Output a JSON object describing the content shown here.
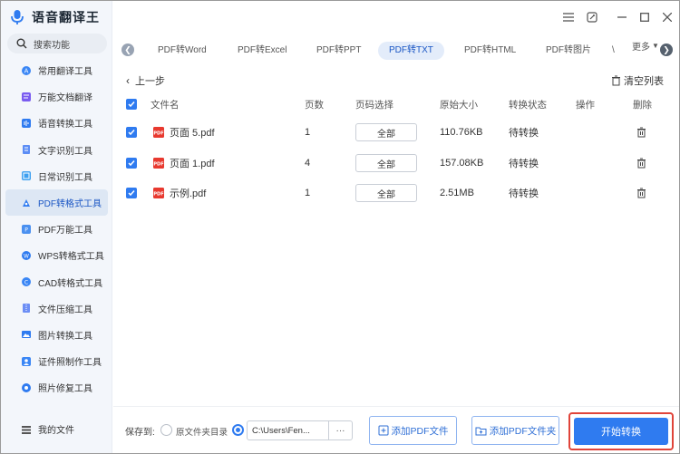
{
  "app": {
    "title": "语音翻译王"
  },
  "search": {
    "label": "搜索功能",
    "icon": "search-icon"
  },
  "sidebar": {
    "items": [
      {
        "label": "常用翻译工具",
        "icon": "translate-icon",
        "active": false
      },
      {
        "label": "万能文档翻译",
        "icon": "document-translate-icon",
        "active": false
      },
      {
        "label": "语音转换工具",
        "icon": "audio-convert-icon",
        "active": false
      },
      {
        "label": "文字识别工具",
        "icon": "text-recognition-icon",
        "active": false
      },
      {
        "label": "日常识别工具",
        "icon": "daily-recognition-icon",
        "active": false
      },
      {
        "label": "PDF转格式工具",
        "icon": "pdf-convert-icon",
        "active": true
      },
      {
        "label": "PDF万能工具",
        "icon": "pdf-tools-icon",
        "active": false
      },
      {
        "label": "WPS转格式工具",
        "icon": "wps-convert-icon",
        "active": false
      },
      {
        "label": "CAD转格式工具",
        "icon": "cad-convert-icon",
        "active": false
      },
      {
        "label": "文件压缩工具",
        "icon": "compress-icon",
        "active": false
      },
      {
        "label": "图片转换工具",
        "icon": "image-convert-icon",
        "active": false
      },
      {
        "label": "证件照制作工具",
        "icon": "id-photo-icon",
        "active": false
      },
      {
        "label": "照片修复工具",
        "icon": "photo-repair-icon",
        "active": false
      }
    ],
    "bottom": {
      "label": "我的文件",
      "icon": "my-files-icon"
    }
  },
  "window_controls": [
    "menu-icon",
    "skin-icon",
    "minimize-icon",
    "maximize-icon",
    "close-icon"
  ],
  "tabs": {
    "items": [
      {
        "label": "PDF转Word",
        "active": false
      },
      {
        "label": "PDF转Excel",
        "active": false
      },
      {
        "label": "PDF转PPT",
        "active": false
      },
      {
        "label": "PDF转TXT",
        "active": true
      },
      {
        "label": "PDF转HTML",
        "active": false
      },
      {
        "label": "PDF转图片",
        "active": false
      }
    ],
    "partial": "\\",
    "more_label": "更多"
  },
  "toolbar": {
    "back_label": "上一步",
    "clear_label": "清空列表"
  },
  "table": {
    "headers": [
      "文件名",
      "页数",
      "页码选择",
      "原始大小",
      "转换状态",
      "操作",
      "删除"
    ],
    "rows": [
      {
        "name": "页面 5.pdf",
        "pages": "1",
        "page_select": "全部",
        "size": "110.76KB",
        "status": "待转换"
      },
      {
        "name": "页面 1.pdf",
        "pages": "4",
        "page_select": "全部",
        "size": "157.08KB",
        "status": "待转换"
      },
      {
        "name": "示例.pdf",
        "pages": "1",
        "page_select": "全部",
        "size": "2.51MB",
        "status": "待转换"
      }
    ]
  },
  "footer": {
    "save_to_label": "保存到:",
    "option_source_label": "原文件夹目录",
    "path_value": "C:\\Users\\Fen...",
    "path_more": "···",
    "add_pdf_label": "添加PDF文件",
    "add_folder_label": "添加PDF文件夹",
    "start_label": "开始转换"
  },
  "colors": {
    "accent": "#2f7bf0",
    "highlight_border": "#e0443a",
    "sidebar_bg": "#f3f6fb"
  }
}
